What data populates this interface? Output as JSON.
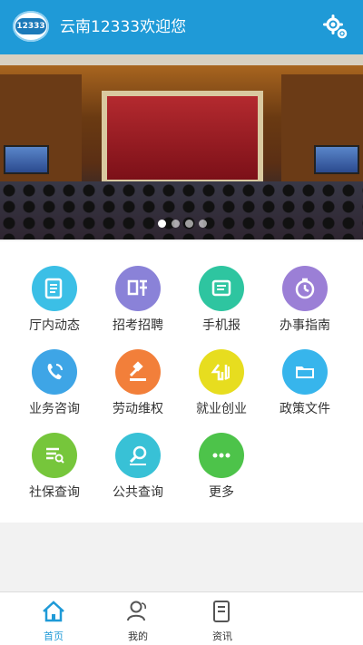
{
  "header": {
    "logo_text": "12333",
    "title": "云南12333欢迎您",
    "settings_icon": "gear-icon"
  },
  "banner": {
    "slides": 4,
    "active_slide": 0
  },
  "grid": {
    "items": [
      {
        "label": "厅内动态",
        "icon": "news-icon",
        "color": "#3bbfe6"
      },
      {
        "label": "招考招聘",
        "icon": "recruit-icon",
        "color": "#8a82d8"
      },
      {
        "label": "手机报",
        "icon": "mobile-newspaper-icon",
        "color": "#2ec5a0"
      },
      {
        "label": "办事指南",
        "icon": "stopwatch-icon",
        "color": "#9b7fd6"
      },
      {
        "label": "业务咨询",
        "icon": "phone-icon",
        "color": "#3ea5e6"
      },
      {
        "label": "劳动维权",
        "icon": "gavel-icon",
        "color": "#f27f3a"
      },
      {
        "label": "就业创业",
        "icon": "entrepreneurship-icon",
        "color": "#e7dd1f"
      },
      {
        "label": "政策文件",
        "icon": "folder-icon",
        "color": "#37b5ec"
      },
      {
        "label": "社保查询",
        "icon": "list-search-icon",
        "color": "#76c63b"
      },
      {
        "label": "公共查询",
        "icon": "search-icon",
        "color": "#38c1d6"
      },
      {
        "label": "更多",
        "icon": "more-icon",
        "color": "#4dc34a"
      }
    ]
  },
  "bottom_nav": {
    "items": [
      {
        "label": "首页",
        "active": true
      },
      {
        "label": "我的",
        "active": false
      },
      {
        "label": "资讯",
        "active": false
      }
    ]
  }
}
